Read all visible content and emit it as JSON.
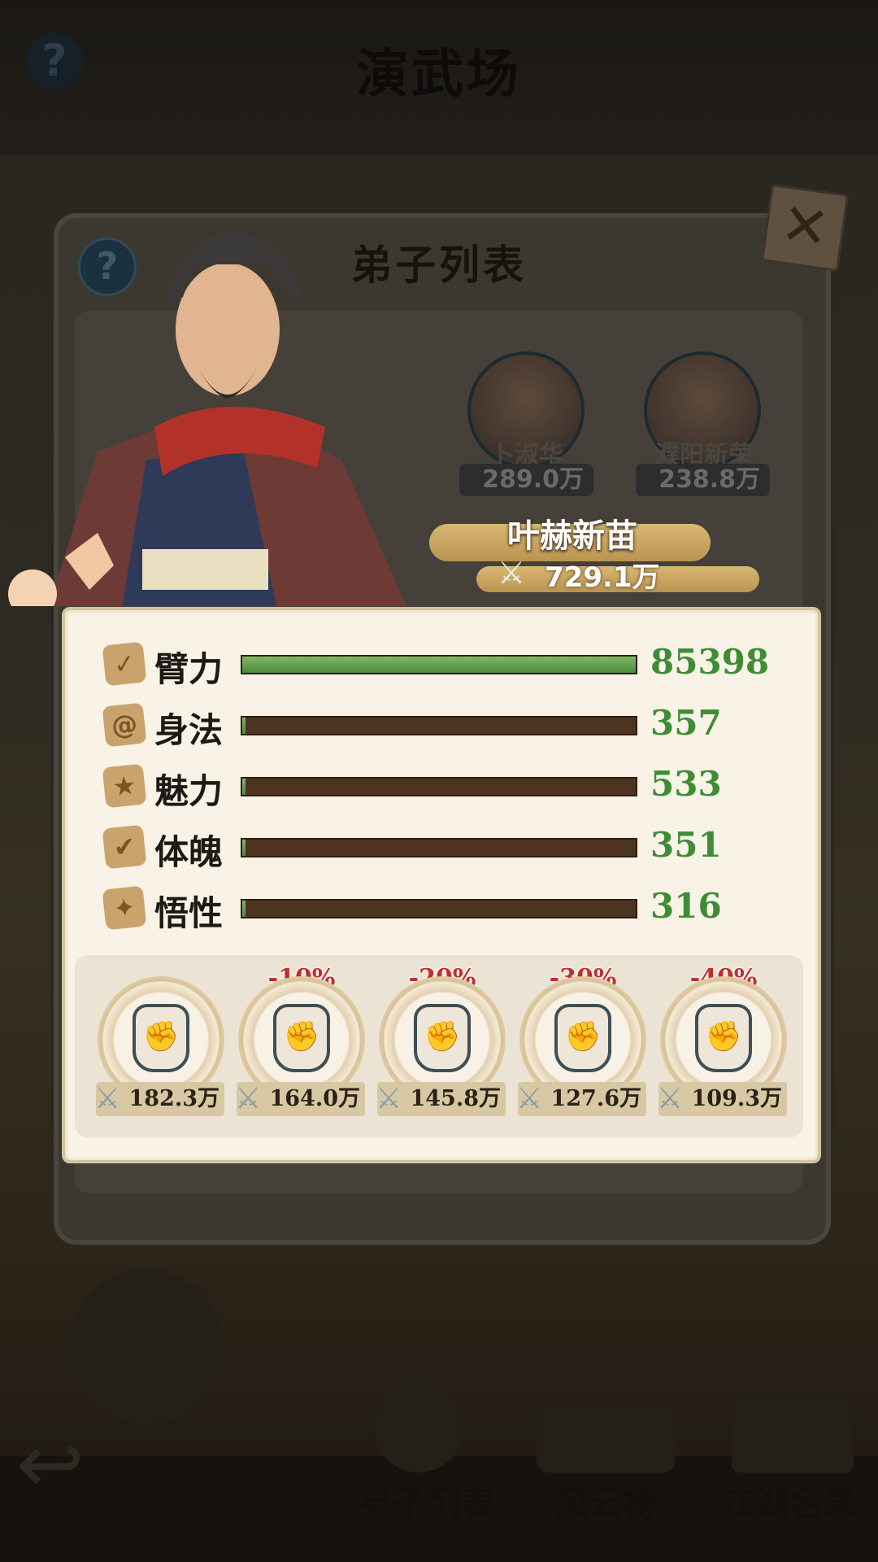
{
  "background": {
    "title": "演武场",
    "nav": [
      {
        "label": "弟子列表"
      },
      {
        "label": "风云榜"
      },
      {
        "label": "江湖名录"
      }
    ]
  },
  "panel": {
    "title": "弟子列表",
    "help_icon": "question-icon",
    "close_icon": "close-icon",
    "disciples": [
      {
        "name": "卜淑华",
        "power": "289.0万"
      },
      {
        "name": "濮阳新荣",
        "power": "238.8万"
      }
    ]
  },
  "selected": {
    "name": "叶赫新苗",
    "power": "729.1万"
  },
  "stats": [
    {
      "label": "臂力",
      "value": "85398",
      "fill": 1.0,
      "icon": "arm-icon"
    },
    {
      "label": "身法",
      "value": "357",
      "fill": 0.004,
      "icon": "whirlwind-icon"
    },
    {
      "label": "魅力",
      "value": "533",
      "fill": 0.006,
      "icon": "star-icon"
    },
    {
      "label": "体魄",
      "value": "351",
      "fill": 0.004,
      "icon": "body-icon"
    },
    {
      "label": "悟性",
      "value": "316",
      "fill": 0.004,
      "icon": "spark-icon"
    }
  ],
  "fists": [
    {
      "discount": "",
      "power": "182.3万"
    },
    {
      "discount": "-10%",
      "power": "164.0万"
    },
    {
      "discount": "-20%",
      "power": "145.8万"
    },
    {
      "discount": "-30%",
      "power": "127.6万"
    },
    {
      "discount": "-40%",
      "power": "109.3万"
    }
  ],
  "colors": {
    "stat_value": "#3e8d35",
    "discount": "#c22c2c",
    "bar_fill": "#5a9a45",
    "bar_track": "#4d3420"
  }
}
